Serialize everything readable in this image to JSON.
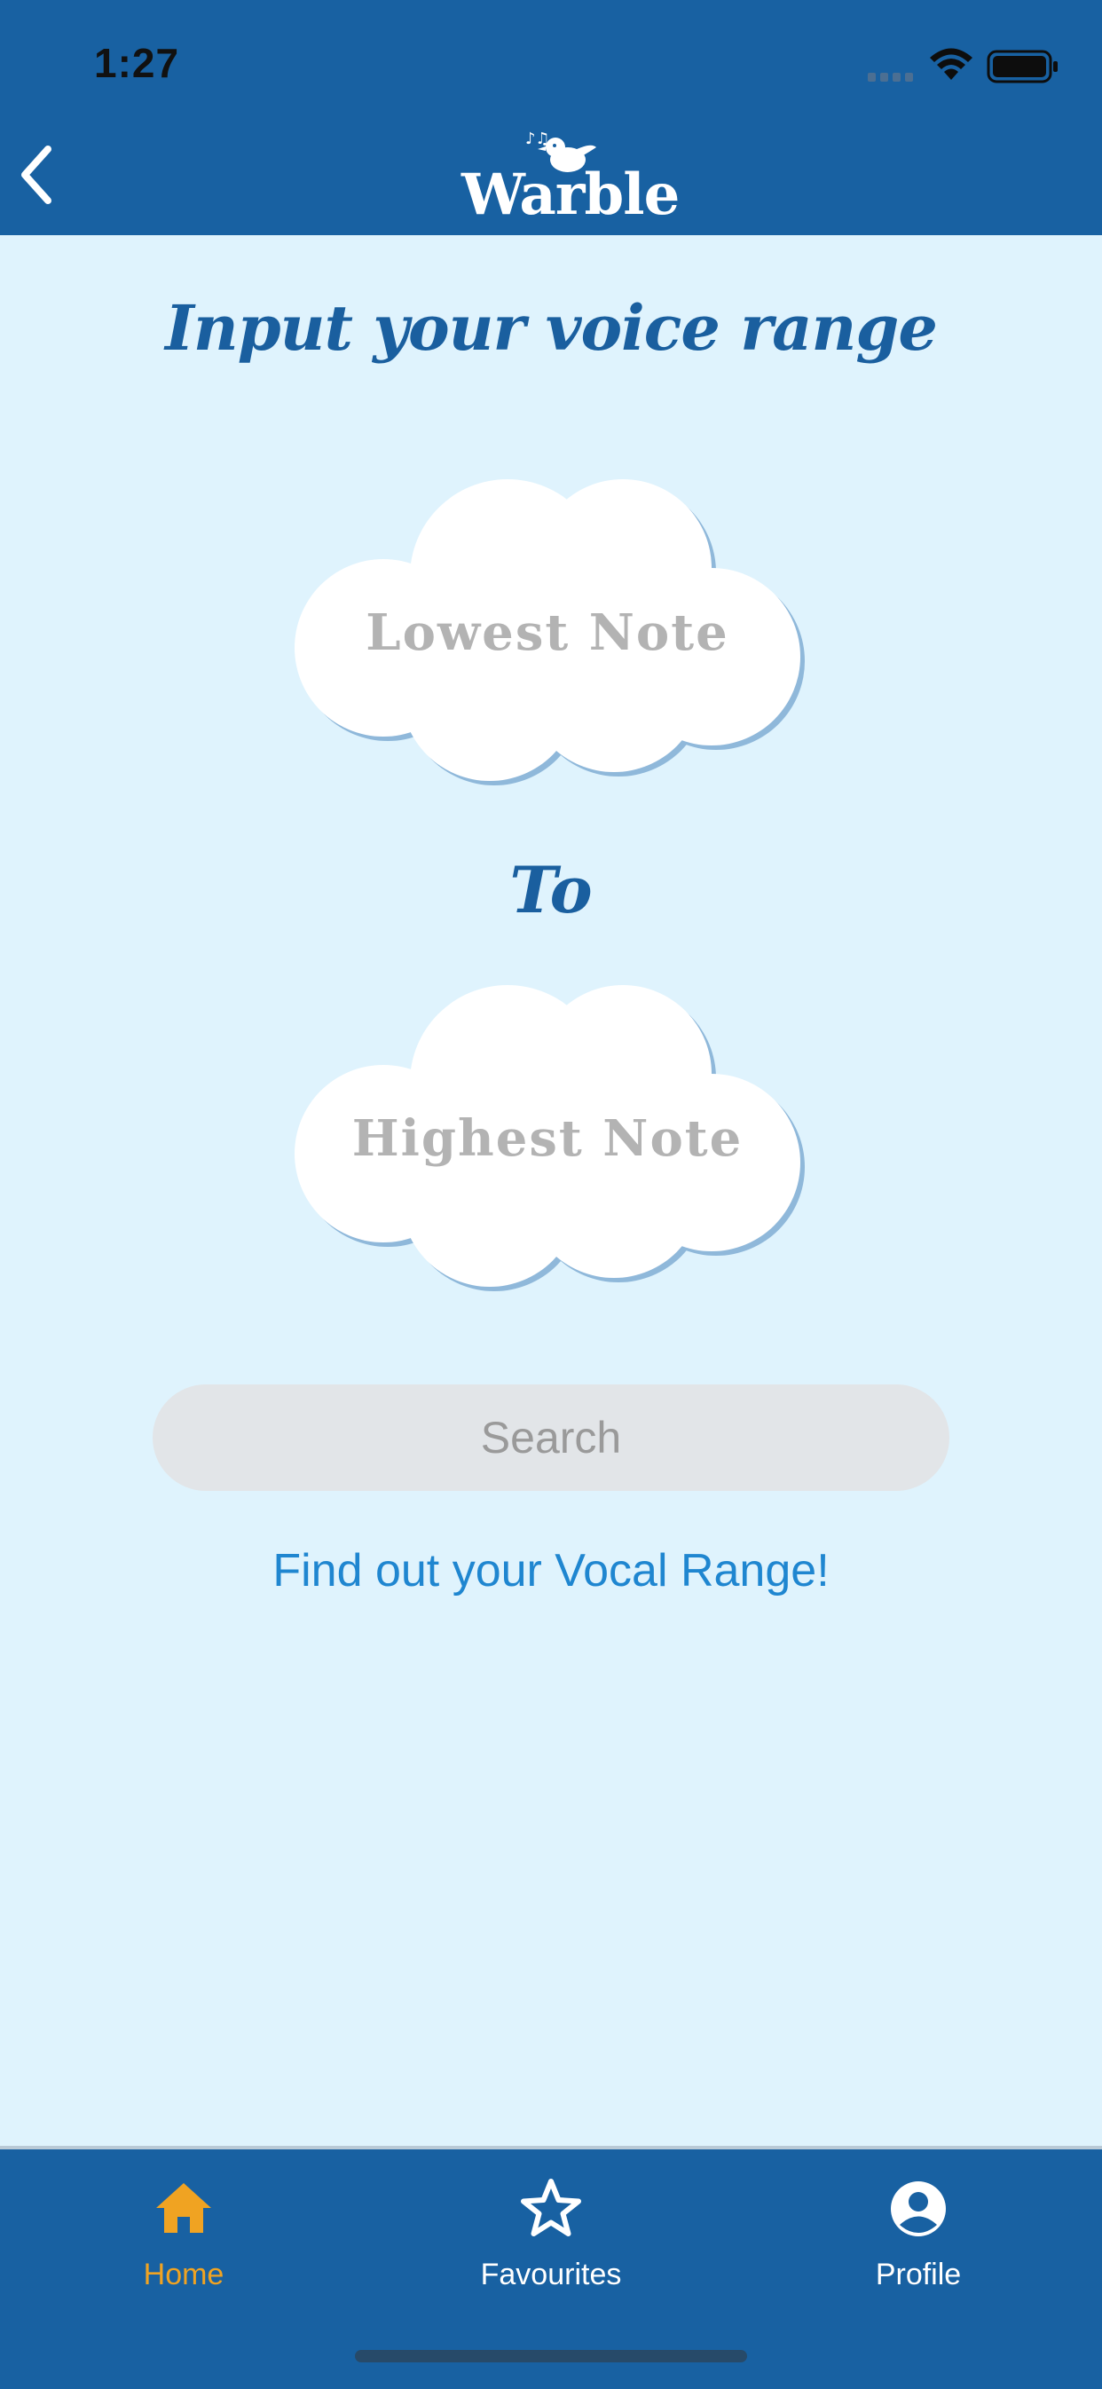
{
  "status_bar": {
    "time": "1:27"
  },
  "nav": {
    "back_icon": "chevron-left-icon",
    "logo_text": "Warble"
  },
  "main": {
    "title": "Input your voice range",
    "lowest_note_placeholder": "Lowest Note",
    "connector": "To",
    "highest_note_placeholder": "Highest Note",
    "search_label": "Search",
    "vocal_range_link": "Find out your Vocal Range!"
  },
  "tabs": [
    {
      "label": "Home",
      "icon": "home-icon",
      "active": true
    },
    {
      "label": "Favourites",
      "icon": "star-icon",
      "active": false
    },
    {
      "label": "Profile",
      "icon": "profile-icon",
      "active": false
    }
  ],
  "colors": {
    "primary": "#1861a2",
    "background": "#dff3fd",
    "accent_active_tab": "#f0a322",
    "link": "#1f86d0",
    "title": "#1a5f9f"
  }
}
